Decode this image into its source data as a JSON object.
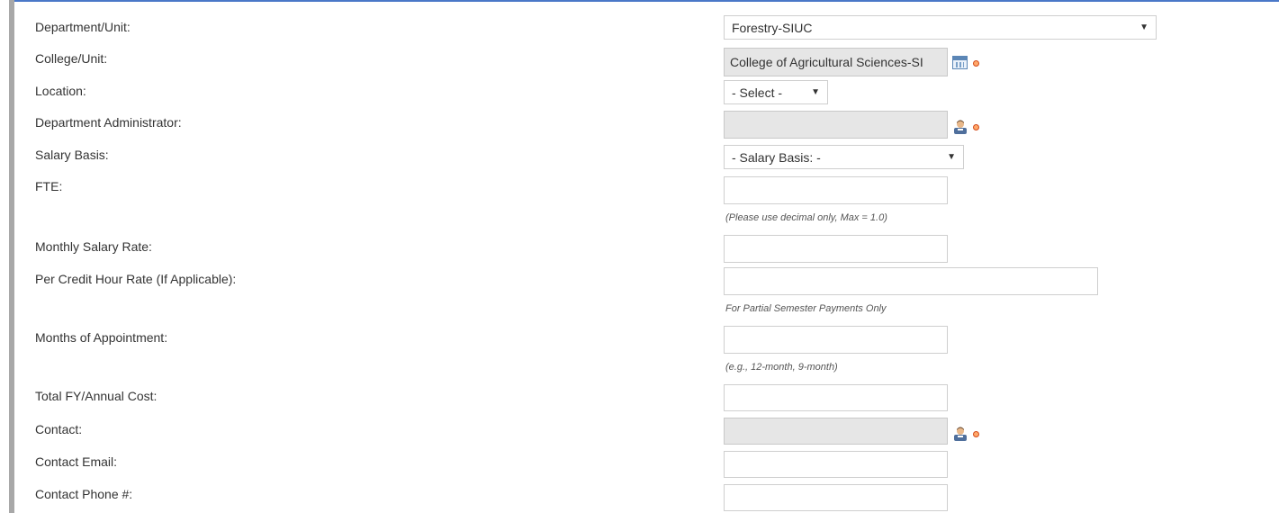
{
  "form": {
    "department_unit": {
      "label": "Department/Unit:",
      "value": "Forestry-SIUC"
    },
    "college_unit": {
      "label": "College/Unit:",
      "value": "College of Agricultural Sciences-SI",
      "icon": "lookup-list-icon"
    },
    "location": {
      "label": "Location:",
      "value": "- Select -"
    },
    "department_administrator": {
      "label": "Department Administrator:",
      "value": "",
      "icon": "person-lookup-icon"
    },
    "salary_basis": {
      "label": "Salary Basis:",
      "value": "- Salary Basis: -"
    },
    "fte": {
      "label": "FTE:",
      "value": "",
      "hint": "(Please use decimal only, Max = 1.0)"
    },
    "monthly_salary_rate": {
      "label": "Monthly Salary Rate:",
      "value": ""
    },
    "per_credit_hour_rate": {
      "label": "Per Credit Hour Rate (If Applicable):",
      "value": "",
      "hint": "For Partial Semester Payments Only"
    },
    "months_of_appointment": {
      "label": "Months of Appointment:",
      "value": "",
      "hint": "(e.g., 12-month, 9-month)"
    },
    "total_fy_annual_cost": {
      "label": "Total FY/Annual Cost:",
      "value": ""
    },
    "contact": {
      "label": "Contact:",
      "value": "",
      "icon": "person-lookup-icon"
    },
    "contact_email": {
      "label": "Contact Email:",
      "value": ""
    },
    "contact_phone": {
      "label": "Contact Phone #:",
      "value": ""
    }
  },
  "colors": {
    "accent_border": "#4a78c8",
    "left_rail": "#a8a8a8",
    "readonly_bg": "#e6e6e6",
    "required_dot": "#ffa86a"
  }
}
